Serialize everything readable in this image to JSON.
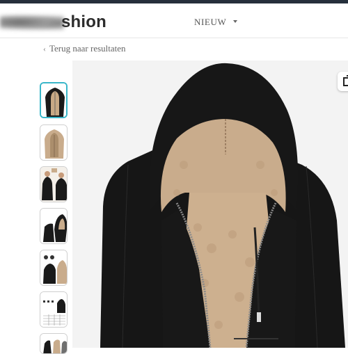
{
  "header": {
    "brand_suffix": "shion",
    "nav_label": "NIEUW"
  },
  "back_link": {
    "label": "Terug naar resultaten"
  },
  "gallery": {
    "thumbnails": [
      {
        "name": "black-hoodie-front",
        "active": true
      },
      {
        "name": "tan-fleece-hoodie"
      },
      {
        "name": "model-collage"
      },
      {
        "name": "hood-detail"
      },
      {
        "name": "size-features"
      },
      {
        "name": "size-chart"
      },
      {
        "name": "color-swatches"
      }
    ]
  },
  "colors": {
    "accent": "#39b6c9",
    "topbar": "#26303c",
    "jacket": "#161616",
    "fleece": "#c9ac8c"
  },
  "icons": {
    "back": "chevron-left-icon",
    "nav_caret": "caret-down-icon",
    "share": "share-icon"
  }
}
